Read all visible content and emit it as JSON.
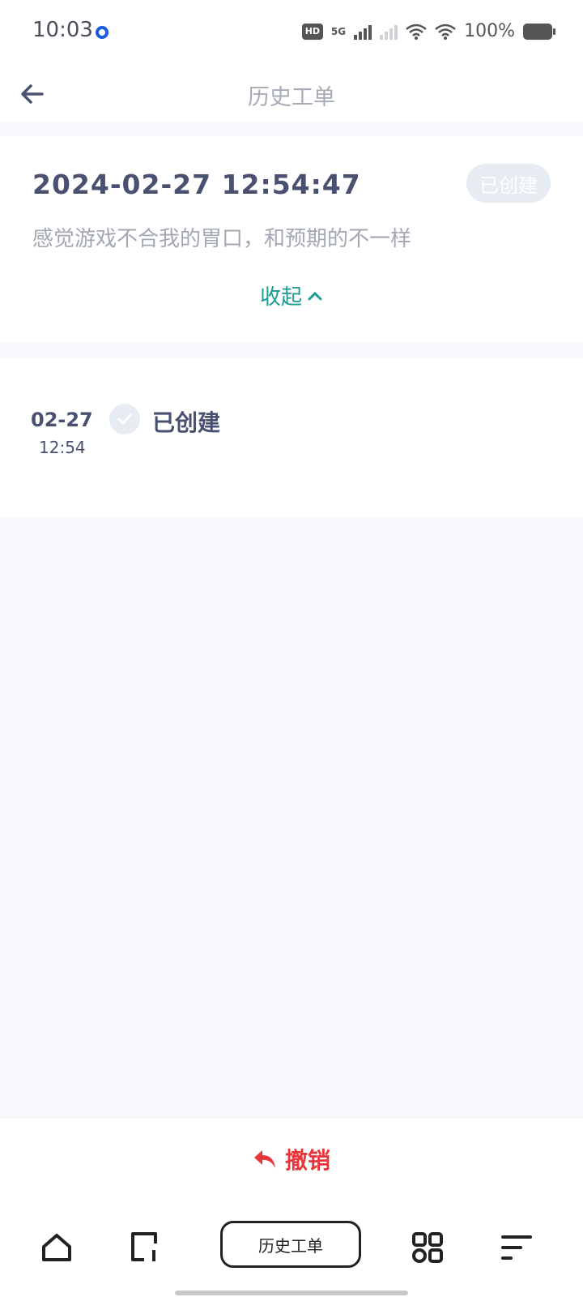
{
  "status_bar": {
    "time": "10:03",
    "hd_label": "HD",
    "network": "5G",
    "battery": "100%"
  },
  "header": {
    "title": "历史工单"
  },
  "ticket": {
    "datetime": "2024-02-27 12:54:47",
    "status": "已创建",
    "description": "感觉游戏不合我的胃口，和预期的不一样",
    "collapse_label": "收起"
  },
  "timeline": {
    "date": "02-27",
    "time": "12:54",
    "state": "已创建"
  },
  "action": {
    "undo_label": "撤销",
    "undo_color": "#e8363a"
  },
  "nav": {
    "center_label": "历史工单"
  },
  "colors": {
    "accent": "#1a9c93",
    "text_dark": "#495070",
    "text_muted": "#a3a8b3"
  }
}
